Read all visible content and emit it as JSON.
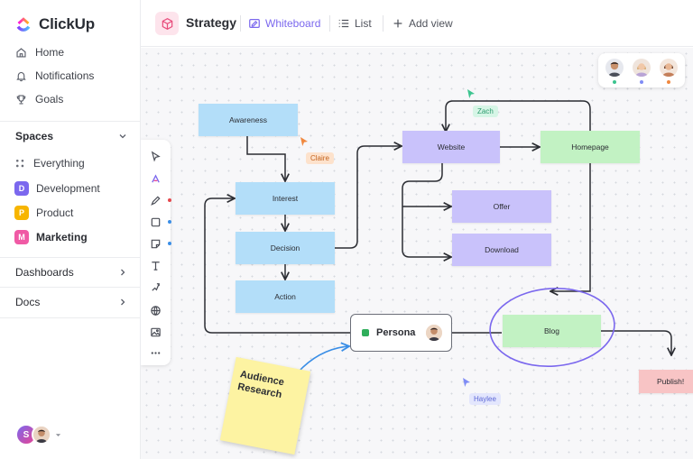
{
  "brand": {
    "name": "ClickUp"
  },
  "nav": {
    "items": [
      {
        "label": "Home",
        "icon": "home-icon"
      },
      {
        "label": "Notifications",
        "icon": "bell-icon"
      },
      {
        "label": "Goals",
        "icon": "trophy-icon"
      }
    ]
  },
  "spaces": {
    "title": "Spaces",
    "everything_label": "Everything",
    "items": [
      {
        "badge": "D",
        "label": "Development",
        "color": "#7b68ee"
      },
      {
        "badge": "P",
        "label": "Product",
        "color": "#f7b500"
      },
      {
        "badge": "M",
        "label": "Marketing",
        "color": "#f05aa5"
      }
    ]
  },
  "sections": {
    "dashboards": "Dashboards",
    "docs": "Docs"
  },
  "user": {
    "initial": "S"
  },
  "header": {
    "title": "Strategy",
    "tabs": {
      "whiteboard": "Whiteboard",
      "list": "List",
      "add_view": "Add view"
    }
  },
  "whiteboard": {
    "nodes": {
      "awareness": "Awareness",
      "interest": "Interest",
      "decision": "Decision",
      "action": "Action",
      "website": "Website",
      "homepage": "Homepage",
      "offer": "Offer",
      "download": "Download",
      "blog": "Blog",
      "publish": "Publish!"
    },
    "persona": "Persona",
    "sticky_note": "Audience Research",
    "cursors": {
      "claire": "Claire",
      "zach": "Zach",
      "haylee": "Haylee"
    },
    "colors": {
      "claire": "#f0883e",
      "zach": "#3cc48f",
      "haylee": "#7f8cf5",
      "blog_circle": "#7b68ee"
    }
  }
}
